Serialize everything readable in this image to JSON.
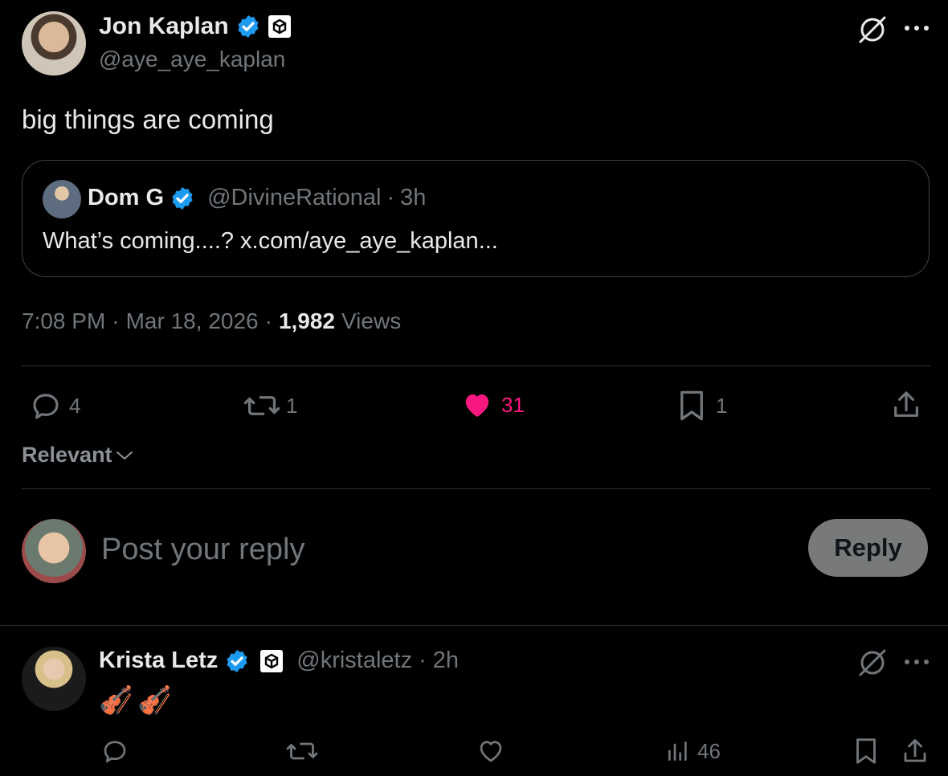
{
  "post": {
    "author_name": "Jon Kaplan",
    "author_handle": "@aye_aye_kaplan",
    "text": "big things are coming",
    "time": "7:08 PM",
    "date": "Mar 18, 2026",
    "views_count": "1,982",
    "views_label": "Views",
    "sep": "·"
  },
  "quote": {
    "author_name": "Dom G",
    "author_handle": "@DivineRational",
    "time": "3h",
    "text": "What’s coming....? x.com/aye_aye_kaplan...",
    "sep": "·"
  },
  "actions": {
    "replies": "4",
    "reposts": "1",
    "likes": "31",
    "bookmarks": "1",
    "like_color": "#f91880"
  },
  "sort": {
    "label": "Relevant"
  },
  "composer": {
    "placeholder": "Post your reply",
    "button_label": "Reply"
  },
  "reply": {
    "author_name": "Krista Letz",
    "author_handle": "@kristaletz",
    "time": "2h",
    "text": "🎻🎻",
    "views": "46",
    "sep": "·"
  },
  "colors": {
    "verified": "#1d9bf0",
    "muted": "#71767b",
    "background": "#000000"
  }
}
